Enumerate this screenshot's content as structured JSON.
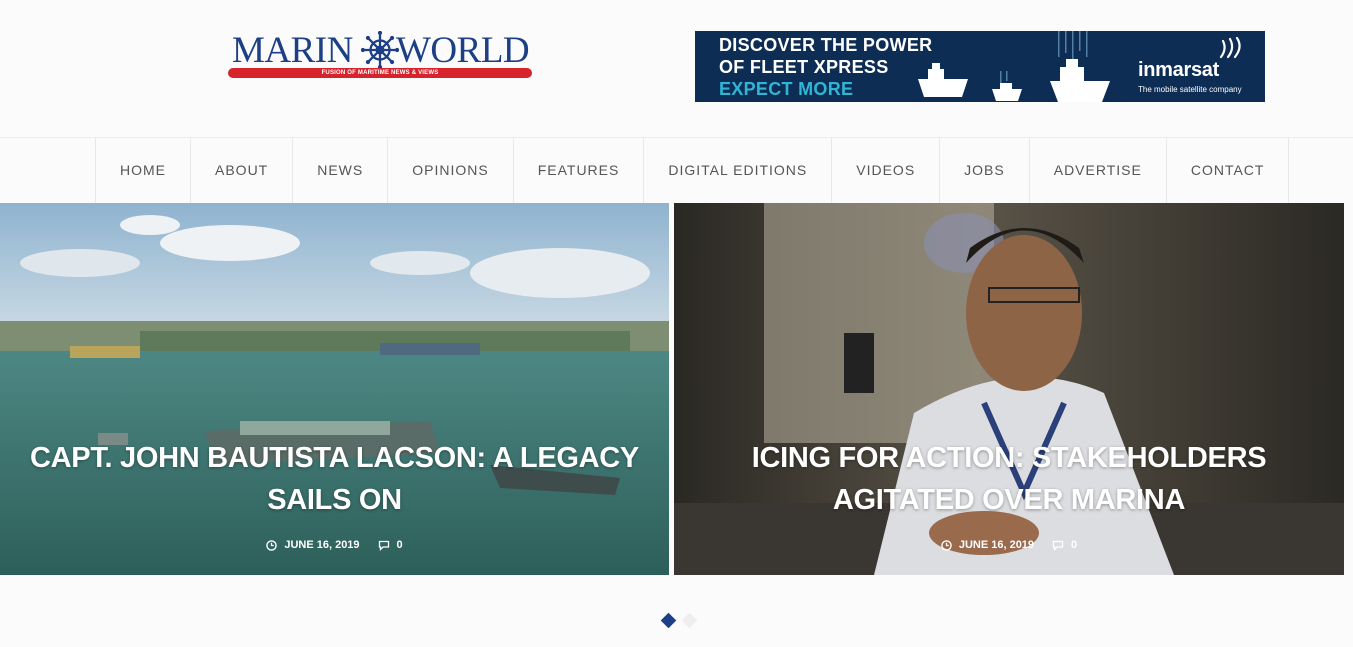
{
  "header": {
    "logo": {
      "word_left": "MARIN",
      "word_right": "WORLD",
      "tagline": "FUSION OF MARITIME NEWS & VIEWS"
    },
    "ad": {
      "line1": "DISCOVER THE POWER",
      "line2": "OF FLEET XPRESS",
      "line3": "EXPECT MORE",
      "brand": "inmarsat",
      "brand_sub": "The mobile satellite company"
    }
  },
  "nav": {
    "items": [
      "HOME",
      "ABOUT",
      "NEWS",
      "OPINIONS",
      "FEATURES",
      "DIGITAL EDITIONS",
      "VIDEOS",
      "JOBS",
      "ADVERTISE",
      "CONTACT"
    ]
  },
  "slides": [
    {
      "title": "CAPT. JOHN BAUTISTA LACSON: A LEGACY SAILS ON",
      "date": "JUNE 16, 2019",
      "comments": "0"
    },
    {
      "title": "ICING FOR ACTION: STAKEHOLDERS AGITATED OVER MARINA",
      "date": "JUNE 16, 2019",
      "comments": "0"
    }
  ],
  "slider": {
    "dot_count": 2,
    "active_dot": 1
  },
  "colors": {
    "brand_blue": "#1c3f86",
    "brand_red": "#d7232b",
    "ad_bg": "#0e2d55",
    "ad_accent": "#2fb6d6",
    "nav_text": "#555555"
  },
  "icons": [
    "ship-wheel-icon",
    "inmarsat-waves-icon",
    "clock-icon",
    "comment-icon"
  ]
}
